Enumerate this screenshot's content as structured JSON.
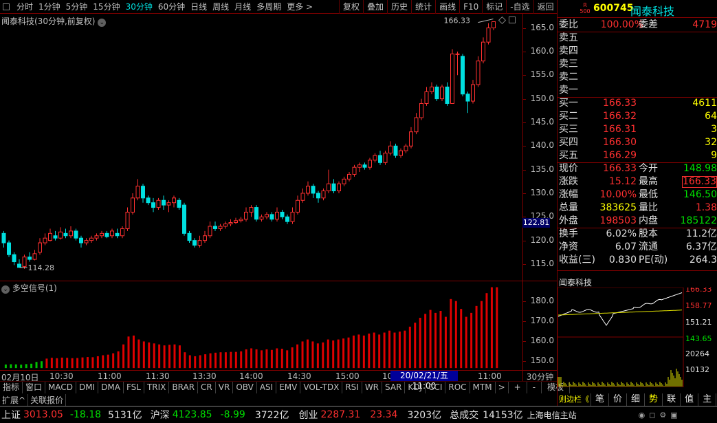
{
  "periods": [
    "分时",
    "1分钟",
    "5分钟",
    "15分钟",
    "30分钟",
    "60分钟",
    "日线",
    "周线",
    "月线",
    "多周期",
    "更多 >"
  ],
  "active_period": "30分钟",
  "tools": [
    "复权",
    "叠加",
    "历史",
    "统计",
    "画线",
    "F10",
    "标记",
    "-自选",
    "返回"
  ],
  "chart_title": "闻泰科技(30分钟,前复权)",
  "indicator_title": "多空信号(1)",
  "price_ticks": [
    "165.0",
    "160.0",
    "155.0",
    "150.0",
    "145.0",
    "140.0",
    "135.0",
    "130.0",
    "125.0",
    "120.0",
    "115.0"
  ],
  "current_price_box": "122.81",
  "high_label": "166.33",
  "low_label": "114.28",
  "ind_ticks": [
    "180.0",
    "170.0",
    "160.0",
    "150.0"
  ],
  "time_ticks": [
    "02月10日",
    "10:30",
    "11:00",
    "11:30",
    "13:30",
    "14:00",
    "14:30",
    "15:00",
    "10:",
    "11:00"
  ],
  "time_highlight": "20/02/21/五 11:00",
  "period_label": "30分钟",
  "ind_tabs": [
    "指标",
    "窗口",
    "MACD",
    "DMI",
    "DMA",
    "FSL",
    "TRIX",
    "BRAR",
    "CR",
    "VR",
    "OBV",
    "ASI",
    "EMV",
    "VOL-TDX",
    "RSI",
    "WR",
    "SAR",
    "KDJ",
    "CCI",
    "ROC",
    "MTM",
    ">"
  ],
  "ind_tabs_right": [
    "+",
    "-",
    "模板"
  ],
  "ext_tabs": [
    "扩展^",
    "关联报价"
  ],
  "stock": {
    "code": "600745",
    "name": "闻泰科技",
    "badge_top": "R",
    "badge_bottom": "500"
  },
  "quote": {
    "weibi_k": "委比",
    "weibi_v": "100.00%",
    "weicha_k": "委差",
    "weicha_v": "4719",
    "sell": [
      {
        "k": "卖五"
      },
      {
        "k": "卖四"
      },
      {
        "k": "卖三"
      },
      {
        "k": "卖二"
      },
      {
        "k": "卖一"
      }
    ],
    "buy": [
      {
        "k": "买一",
        "p": "166.33",
        "q": "4611"
      },
      {
        "k": "买二",
        "p": "166.32",
        "q": "64"
      },
      {
        "k": "买三",
        "p": "166.31",
        "q": "3"
      },
      {
        "k": "买四",
        "p": "166.30",
        "q": "32"
      },
      {
        "k": "买五",
        "p": "166.29",
        "q": "9"
      }
    ],
    "stats": [
      {
        "k": "现价",
        "v": "166.33",
        "k2": "今开",
        "v2": "148.98"
      },
      {
        "k": "涨跌",
        "v": "15.12",
        "k2": "最高",
        "v2": "166.33"
      },
      {
        "k": "涨幅",
        "v": "10.00%",
        "k2": "最低",
        "v2": "146.50"
      },
      {
        "k": "总量",
        "v": "383625",
        "k2": "量比",
        "v2": "1.38"
      },
      {
        "k": "外盘",
        "v": "198503",
        "k2": "内盘",
        "v2": "185122"
      },
      {
        "k": "换手",
        "v": "6.02%",
        "k2": "股本",
        "v2": "11.2亿"
      },
      {
        "k": "净资",
        "v": "6.07",
        "k2": "流通",
        "v2": "6.37亿"
      },
      {
        "k": "收益(三)",
        "v": "0.830",
        "k2": "PE(动)",
        "v2": "264.3"
      }
    ]
  },
  "mini": {
    "title": "闻泰科技",
    "prices": [
      "166.33",
      "158.77",
      "151.21",
      "143.65"
    ],
    "vols": [
      "20264",
      "10132"
    ]
  },
  "right_tabs": [
    "笔",
    "价",
    "细",
    "势",
    "联",
    "值",
    "主",
    "筹"
  ],
  "right_tabs_prefix": "则边栏《",
  "status": {
    "sh_label": "上证",
    "sh_val": "3013.05",
    "sh_chg": "-18.18",
    "sh_amt": "5131亿",
    "hs_label": "沪深",
    "hs_val": "4123.85",
    "hs_chg": "-8.99",
    "hs_amt": "3722亿",
    "cy_label": "创业",
    "cy_val": "2287.31",
    "cy_chg": "23.34",
    "cy_amt": "3203亿",
    "total_label": "总成交",
    "total_val": "14153亿",
    "server": "上海电信主站"
  },
  "colors": {
    "up": "#ff3030",
    "down": "#00e0e0",
    "ind_up": "#e00000",
    "ind_down": "#00c000"
  },
  "candles": [
    [
      121.5,
      119.5,
      122.0,
      118.5
    ],
    [
      119.5,
      117.0,
      120.0,
      116.5
    ],
    [
      117.0,
      115.5,
      117.5,
      114.8
    ],
    [
      115.0,
      114.3,
      116.0,
      114.28
    ],
    [
      114.5,
      116.5,
      117.0,
      114.0
    ],
    [
      116.5,
      116.0,
      117.5,
      115.5
    ],
    [
      116.0,
      117.2,
      118.0,
      115.8
    ],
    [
      117.5,
      119.5,
      120.5,
      117.0
    ],
    [
      119.5,
      120.5,
      121.5,
      119.0
    ],
    [
      120.0,
      121.5,
      122.5,
      119.8
    ],
    [
      121.0,
      120.5,
      122.0,
      120.0
    ],
    [
      120.5,
      121.8,
      122.8,
      120.2
    ],
    [
      121.5,
      121.0,
      122.5,
      120.5
    ],
    [
      121.0,
      122.0,
      123.0,
      120.5
    ],
    [
      122.0,
      120.5,
      122.5,
      120.0
    ],
    [
      120.5,
      119.5,
      121.0,
      118.5
    ],
    [
      119.5,
      120.0,
      120.5,
      119.0
    ],
    [
      120.0,
      120.5,
      121.0,
      119.5
    ],
    [
      120.5,
      121.0,
      121.5,
      120.0
    ],
    [
      121.0,
      121.5,
      122.0,
      120.5
    ],
    [
      121.5,
      120.8,
      122.0,
      120.5
    ],
    [
      121.0,
      122.0,
      122.5,
      120.5
    ],
    [
      121.5,
      121.0,
      122.5,
      120.5
    ],
    [
      121.0,
      122.5,
      123.0,
      120.5
    ],
    [
      122.5,
      126.0,
      127.0,
      122.0
    ],
    [
      126.0,
      129.0,
      130.0,
      125.5
    ],
    [
      129.0,
      131.5,
      133.0,
      128.5
    ],
    [
      131.5,
      129.0,
      132.0,
      128.0
    ],
    [
      129.0,
      128.0,
      129.5,
      127.5
    ],
    [
      128.0,
      127.0,
      129.0,
      126.0
    ],
    [
      127.0,
      128.5,
      129.0,
      126.5
    ],
    [
      128.5,
      127.5,
      129.5,
      126.5
    ],
    [
      127.5,
      128.0,
      128.5,
      126.0
    ],
    [
      128.0,
      129.0,
      129.5,
      127.0
    ],
    [
      128.5,
      127.0,
      129.0,
      126.5
    ],
    [
      127.5,
      121.5,
      128.0,
      121.0
    ],
    [
      121.5,
      120.0,
      122.0,
      119.5
    ],
    [
      120.0,
      119.0,
      120.5,
      118.5
    ],
    [
      119.0,
      120.0,
      121.0,
      118.5
    ],
    [
      120.0,
      121.0,
      122.0,
      119.5
    ],
    [
      121.0,
      123.0,
      124.0,
      120.5
    ],
    [
      123.0,
      122.5,
      124.0,
      122.0
    ],
    [
      122.5,
      123.0,
      123.5,
      122.0
    ],
    [
      123.0,
      123.5,
      124.0,
      122.5
    ],
    [
      123.5,
      123.8,
      124.5,
      123.0
    ],
    [
      123.8,
      124.2,
      124.8,
      123.5
    ],
    [
      124.2,
      124.5,
      125.0,
      123.8
    ],
    [
      124.5,
      126.0,
      127.0,
      124.0
    ],
    [
      126.0,
      127.0,
      127.5,
      125.0
    ],
    [
      127.0,
      124.5,
      127.5,
      124.0
    ],
    [
      124.5,
      125.0,
      125.5,
      124.0
    ],
    [
      125.0,
      125.5,
      126.0,
      124.5
    ],
    [
      125.5,
      124.5,
      126.0,
      124.0
    ],
    [
      124.5,
      126.0,
      127.0,
      124.0
    ],
    [
      126.0,
      125.0,
      126.5,
      124.5
    ],
    [
      125.0,
      124.0,
      125.5,
      123.5
    ],
    [
      124.0,
      126.0,
      127.0,
      123.5
    ],
    [
      126.0,
      128.5,
      129.5,
      125.5
    ],
    [
      128.5,
      130.0,
      131.0,
      128.0
    ],
    [
      130.0,
      131.5,
      132.5,
      129.5
    ],
    [
      131.5,
      130.0,
      132.0,
      129.0
    ],
    [
      130.0,
      129.0,
      130.5,
      128.0
    ],
    [
      129.0,
      130.5,
      131.0,
      128.5
    ],
    [
      130.5,
      132.0,
      135.0,
      130.0
    ],
    [
      132.0,
      130.5,
      133.0,
      130.0
    ],
    [
      130.5,
      132.0,
      132.5,
      130.0
    ],
    [
      132.0,
      133.0,
      133.5,
      131.5
    ],
    [
      133.0,
      134.0,
      134.5,
      132.5
    ],
    [
      134.0,
      135.5,
      136.0,
      133.5
    ],
    [
      135.5,
      136.0,
      136.5,
      134.5
    ],
    [
      136.0,
      135.5,
      136.5,
      135.0
    ],
    [
      135.5,
      137.0,
      137.5,
      135.0
    ],
    [
      137.0,
      138.0,
      138.5,
      136.5
    ],
    [
      138.0,
      136.5,
      139.0,
      136.0
    ],
    [
      136.5,
      138.5,
      139.0,
      136.0
    ],
    [
      138.5,
      140.0,
      141.0,
      138.0
    ],
    [
      140.0,
      138.0,
      140.5,
      137.5
    ],
    [
      138.0,
      139.0,
      139.5,
      137.5
    ],
    [
      139.0,
      140.0,
      140.5,
      138.5
    ],
    [
      140.0,
      143.0,
      144.0,
      139.5
    ],
    [
      143.0,
      146.0,
      147.0,
      142.5
    ],
    [
      146.0,
      149.0,
      150.0,
      145.5
    ],
    [
      149.0,
      151.5,
      152.5,
      148.5
    ],
    [
      151.5,
      152.5,
      153.5,
      151.0
    ],
    [
      152.5,
      150.0,
      153.0,
      149.5
    ],
    [
      150.0,
      152.5,
      153.0,
      149.5
    ],
    [
      152.5,
      149.0,
      153.5,
      148.5
    ],
    [
      149.0,
      159.5,
      160.5,
      149.0
    ],
    [
      159.5,
      159.5,
      160.0,
      155.0
    ],
    [
      159.0,
      151.0,
      159.5,
      150.5
    ],
    [
      151.0,
      149.5,
      151.5,
      147.0
    ],
    [
      149.5,
      153.0,
      154.0,
      149.0
    ],
    [
      153.0,
      158.0,
      159.0,
      152.5
    ],
    [
      158.0,
      162.0,
      163.0,
      157.5
    ],
    [
      162.0,
      165.0,
      166.0,
      161.5
    ],
    [
      165.0,
      166.33,
      166.33,
      164.5
    ]
  ],
  "indicator": [
    148.6,
    148.8,
    148.7,
    148.5,
    148.9,
    149.2,
    150.5,
    151.0,
    150.8,
    151.2,
    151.0,
    151.3,
    151.2,
    151.0,
    151.1,
    151.4,
    151.6,
    151.5,
    152.0,
    152.5,
    152.8,
    153.5,
    154.5,
    158.0,
    162.0,
    162.5,
    160.5,
    159.5,
    159.0,
    158.5,
    158.0,
    157.5,
    157.8,
    158.0,
    157.5,
    154.0,
    152.5,
    152.0,
    152.5,
    153.0,
    153.5,
    153.8,
    154.0,
    154.0,
    154.2,
    154.2,
    154.5,
    155.5,
    156.0,
    155.5,
    155.0,
    155.5,
    155.2,
    156.0,
    155.8,
    155.0,
    156.5,
    158.0,
    159.5,
    160.5,
    159.5,
    158.5,
    159.0,
    160.5,
    160.0,
    160.5,
    161.0,
    161.5,
    162.5,
    163.0,
    162.5,
    163.5,
    164.0,
    163.0,
    164.0,
    165.0,
    164.0,
    164.5,
    165.0,
    167.0,
    169.0,
    171.5,
    173.5,
    175.5,
    174.0,
    175.0,
    172.0,
    181.0,
    180.0,
    176.0,
    172.0,
    174.0,
    177.5,
    180.0,
    184.0,
    187.0,
    187.0
  ]
}
